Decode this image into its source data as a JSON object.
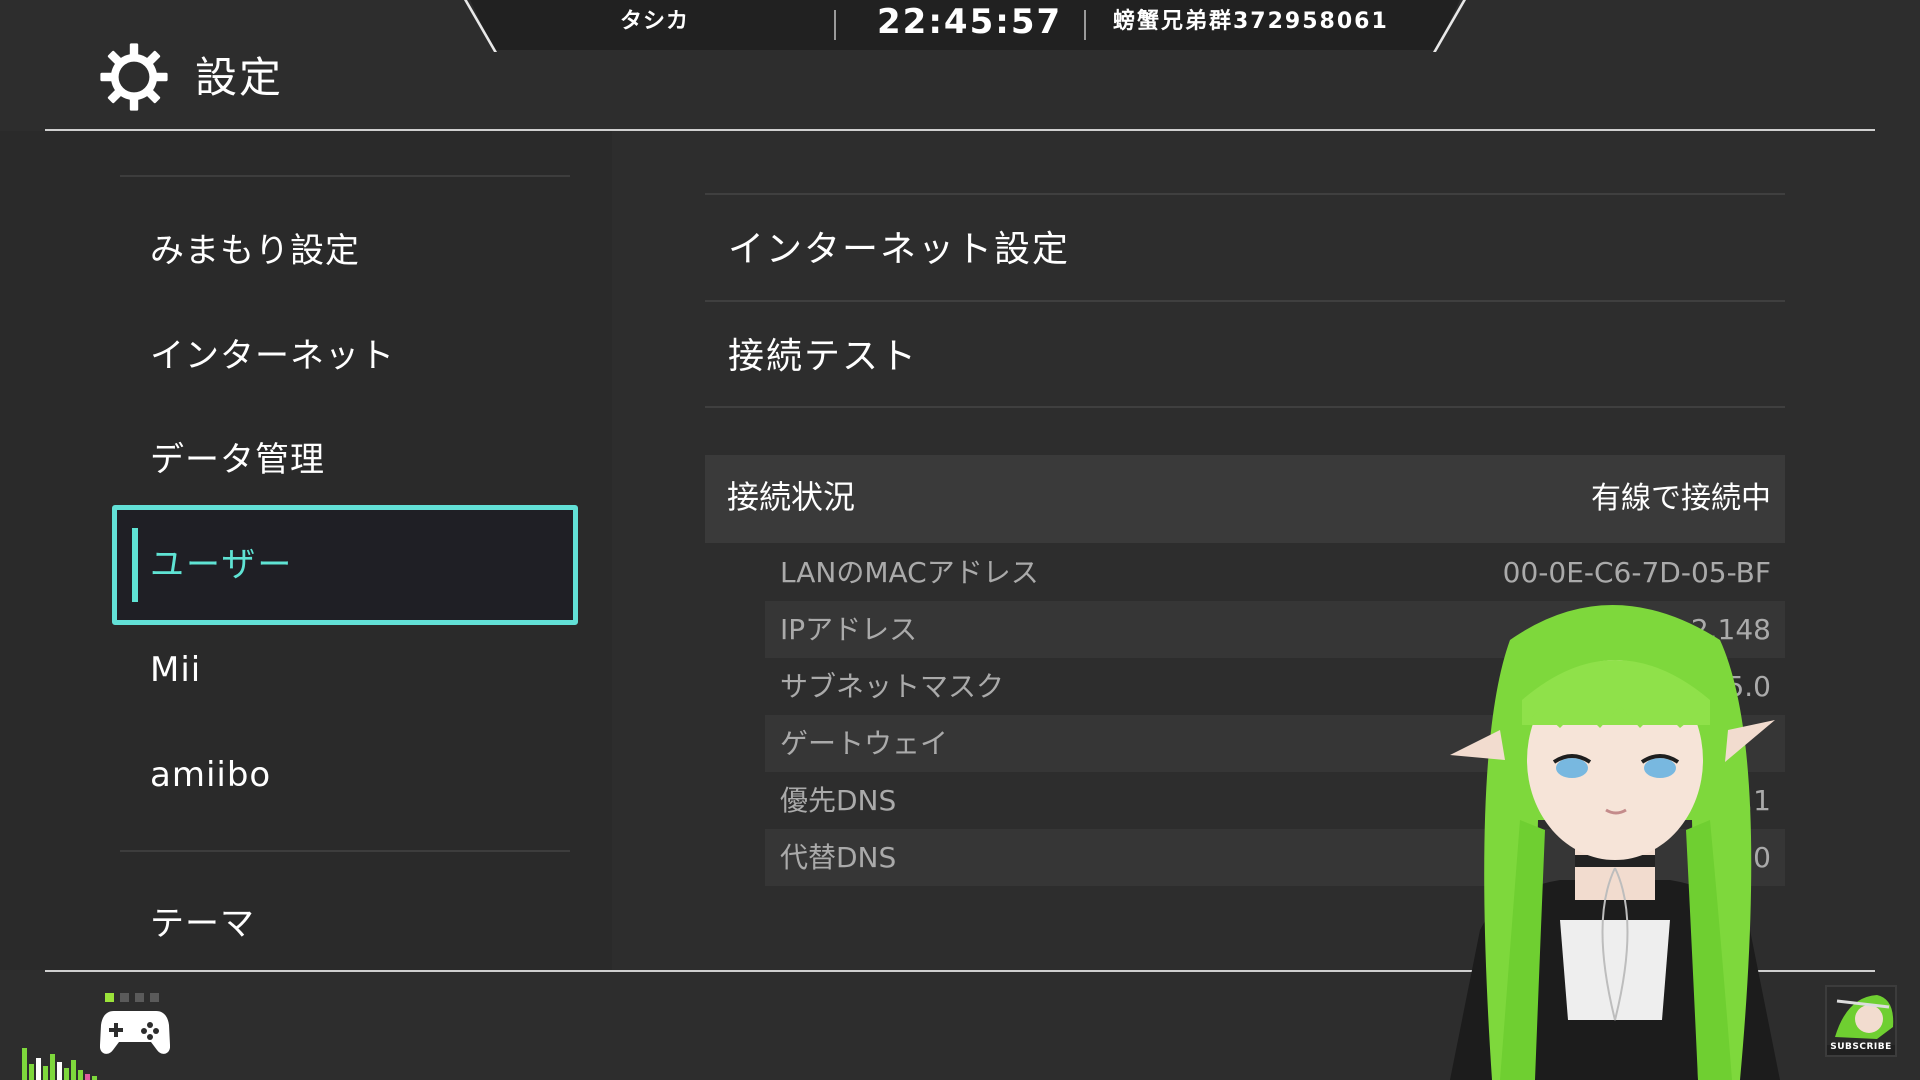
{
  "banner": {
    "left_text": "タシカ",
    "clock": "22:45:57",
    "right_text": "螃蟹兄弟群372958061"
  },
  "header": {
    "title": "設定",
    "icon": "gear-icon"
  },
  "sidebar": {
    "items": [
      {
        "label": "みまもり設定"
      },
      {
        "label": "インターネット"
      },
      {
        "label": "データ管理"
      },
      {
        "label": "ユーザー",
        "selected": true
      },
      {
        "label": "Mii"
      },
      {
        "label": "amiibo"
      },
      {
        "label": "テーマ"
      }
    ]
  },
  "main": {
    "options": [
      {
        "label": "インターネット設定"
      },
      {
        "label": "接続テスト"
      }
    ],
    "status": {
      "label": "接続状況",
      "value": "有線で接続中"
    },
    "details": [
      {
        "label": "LANのMACアドレス",
        "value": "00-0E-C6-7D-05-BF"
      },
      {
        "label": "IPアドレス",
        "value": "2.148"
      },
      {
        "label": "サブネットマスク",
        "value": "5.0"
      },
      {
        "label": "ゲートウェイ",
        "value": ""
      },
      {
        "label": "優先DNS",
        "value": ".2.1"
      },
      {
        "label": "代替DNS",
        "value": ".0.0"
      }
    ]
  },
  "footer": {
    "controller_icon": "gamepad-icon",
    "player_indicator": 1,
    "subscribe_label": "SUBSCRIBE"
  },
  "colors": {
    "background": "#2d2d2d",
    "sidebar": "#2a2a2a",
    "accent": "#5fe3d4",
    "highlight_border": "#62e0d6",
    "status_row": "#3a3a3a",
    "muted_text": "#aaaaaa",
    "avatar_hair": "#7ed83c"
  }
}
